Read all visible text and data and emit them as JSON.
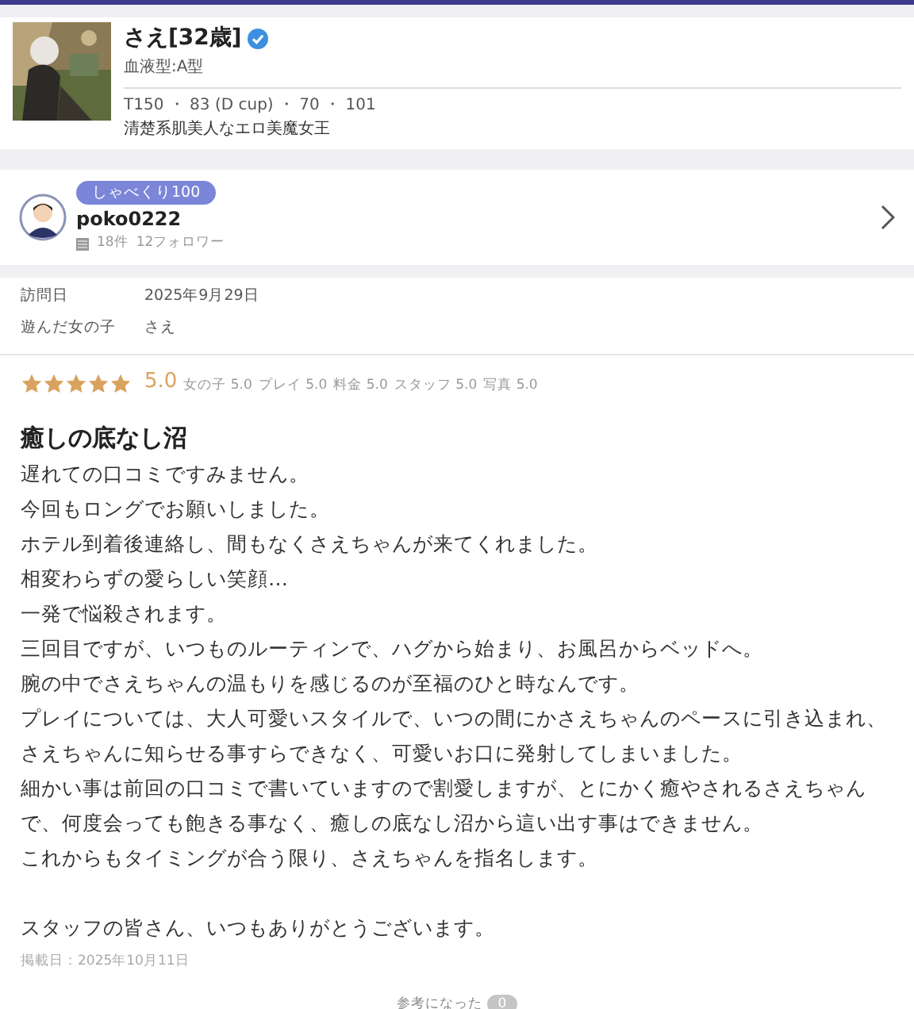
{
  "profile": {
    "name": "さえ[32歳]",
    "verified": true,
    "blood_type": "血液型:A型",
    "measurements": "T150 ・ 83 (D cup) ・ 70 ・ 101",
    "catchphrase": "清楚系肌美人なエロ美魔女王"
  },
  "reviewer": {
    "badge": "しゃべくり100",
    "name": "poko0222",
    "reviews": "18件",
    "followers": "12フォロワー"
  },
  "info": [
    {
      "label": "訪問日",
      "value": "2025年9月29日"
    },
    {
      "label": "遊んだ女の子",
      "value": "さえ"
    }
  ],
  "rating": {
    "stars": 5,
    "score": "5.0",
    "items": [
      "女の子 5.0",
      "プレイ 5.0",
      "料金 5.0",
      "スタッフ 5.0",
      "写真 5.0"
    ]
  },
  "review": {
    "title": "癒しの底なし沼",
    "body": [
      "遅れての口コミですみません。",
      "今回もロングでお願いしました。",
      "ホテル到着後連絡し、間もなくさえちゃんが来てくれました。",
      "相変わらずの愛らしい笑顔…",
      "一発で悩殺されます。",
      "三回目ですが、いつものルーティンで、ハグから始まり、お風呂からベッドへ。",
      "腕の中でさえちゃんの温もりを感じるのが至福のひと時なんです。",
      "プレイについては、大人可愛いスタイルで、いつの間にかさえちゃんのペースに引き込まれ、さえちゃんに知らせる事すらできなく、可愛いお口に発射してしまいました。",
      "細かい事は前回の口コミで書いていますので割愛しますが、とにかく癒やされるさえちゃんで、何度会っても飽きる事なく、癒しの底なし沼から這い出す事はできません。",
      "これからもタイミングが合う限り、さえちゃんを指名します。"
    ],
    "closing": "スタッフの皆さん、いつもありがとうございます。",
    "posted": "掲載日：2025年10月11日"
  },
  "helpful": {
    "label": "参考になった",
    "count": "0"
  }
}
